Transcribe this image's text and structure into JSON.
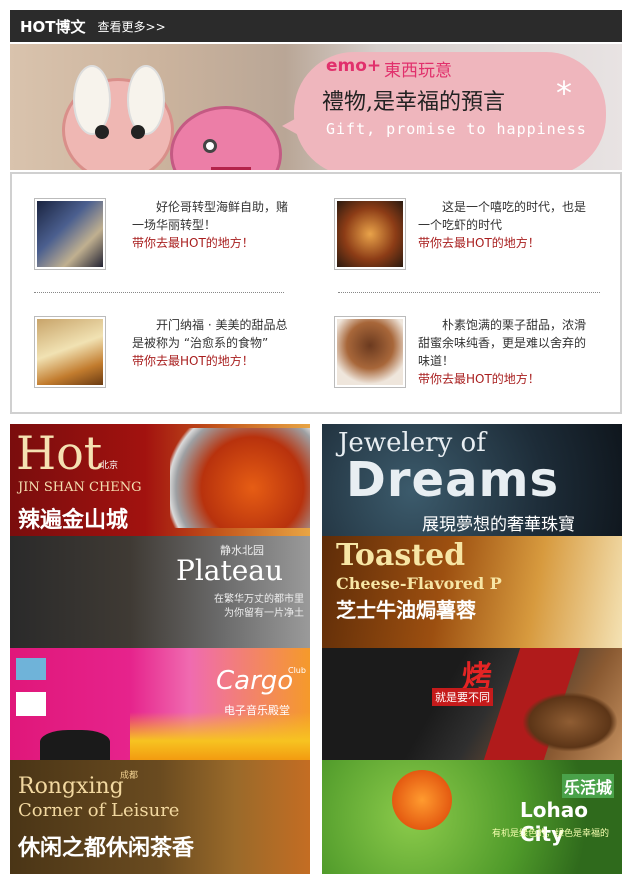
{
  "header": {
    "title": "HOT博文",
    "more": "查看更多>>"
  },
  "banner": {
    "brand": "emo+",
    "brand_cn": "東西玩意",
    "slogan_cn": "禮物,是幸福的預言",
    "star": "*",
    "slogan_en": "Gift, promise to happiness"
  },
  "hot": {
    "items": [
      {
        "text": "好伦哥转型海鲜自助，赌一场华丽转型！",
        "link": "带你去最HOT的地方！"
      },
      {
        "text": "这是一个嘻吃的时代，也是一个吃虾的时代",
        "link": "带你去最HOT的地方！"
      },
      {
        "text": "开门纳福 · 美美的甜品总是被称为 “治愈系的食物”",
        "link": "带你去最HOT的地方！"
      },
      {
        "text": "朴素饱满的栗子甜品，浓滑甜蜜余味纯香，更是难以舍弃的味道！",
        "link": "带你去最HOT的地方！"
      }
    ]
  },
  "tiles": {
    "hot_title": "Hot",
    "hot_city": "北京",
    "hot_sub": "JIN SHAN CHENG",
    "hot_cn": "辣遍金山城",
    "jewel_top": "Jewelery of",
    "jewel_main": "Dreams",
    "jewel_cn": "展現夢想的奢華珠寶",
    "plateau_cn": "静水北园",
    "plateau_title": "Plateau",
    "plateau_line1": "在繁华万丈的都市里",
    "plateau_line2": "为你留有一片净土",
    "toasted_title": "Toasted",
    "toasted_sub": "Cheese-Flavored P",
    "toasted_cn": "芝士牛油焗薯蓉",
    "cargo_title": "Cargo",
    "cargo_club": "Club",
    "cargo_cn": "电子音乐殿堂",
    "grill_cn": "烤",
    "grill_sub": "就是要不同",
    "rong_city": "成都",
    "rong_title1": "Rongxing",
    "rong_title2": "Corner of Leisure",
    "rong_cn": "休闲之都休闲茶香",
    "lohao_cn": "乐活城",
    "lohao_title": "Lohao City",
    "lohao_slogan": "有机是绿色的，绿色是幸福的"
  }
}
